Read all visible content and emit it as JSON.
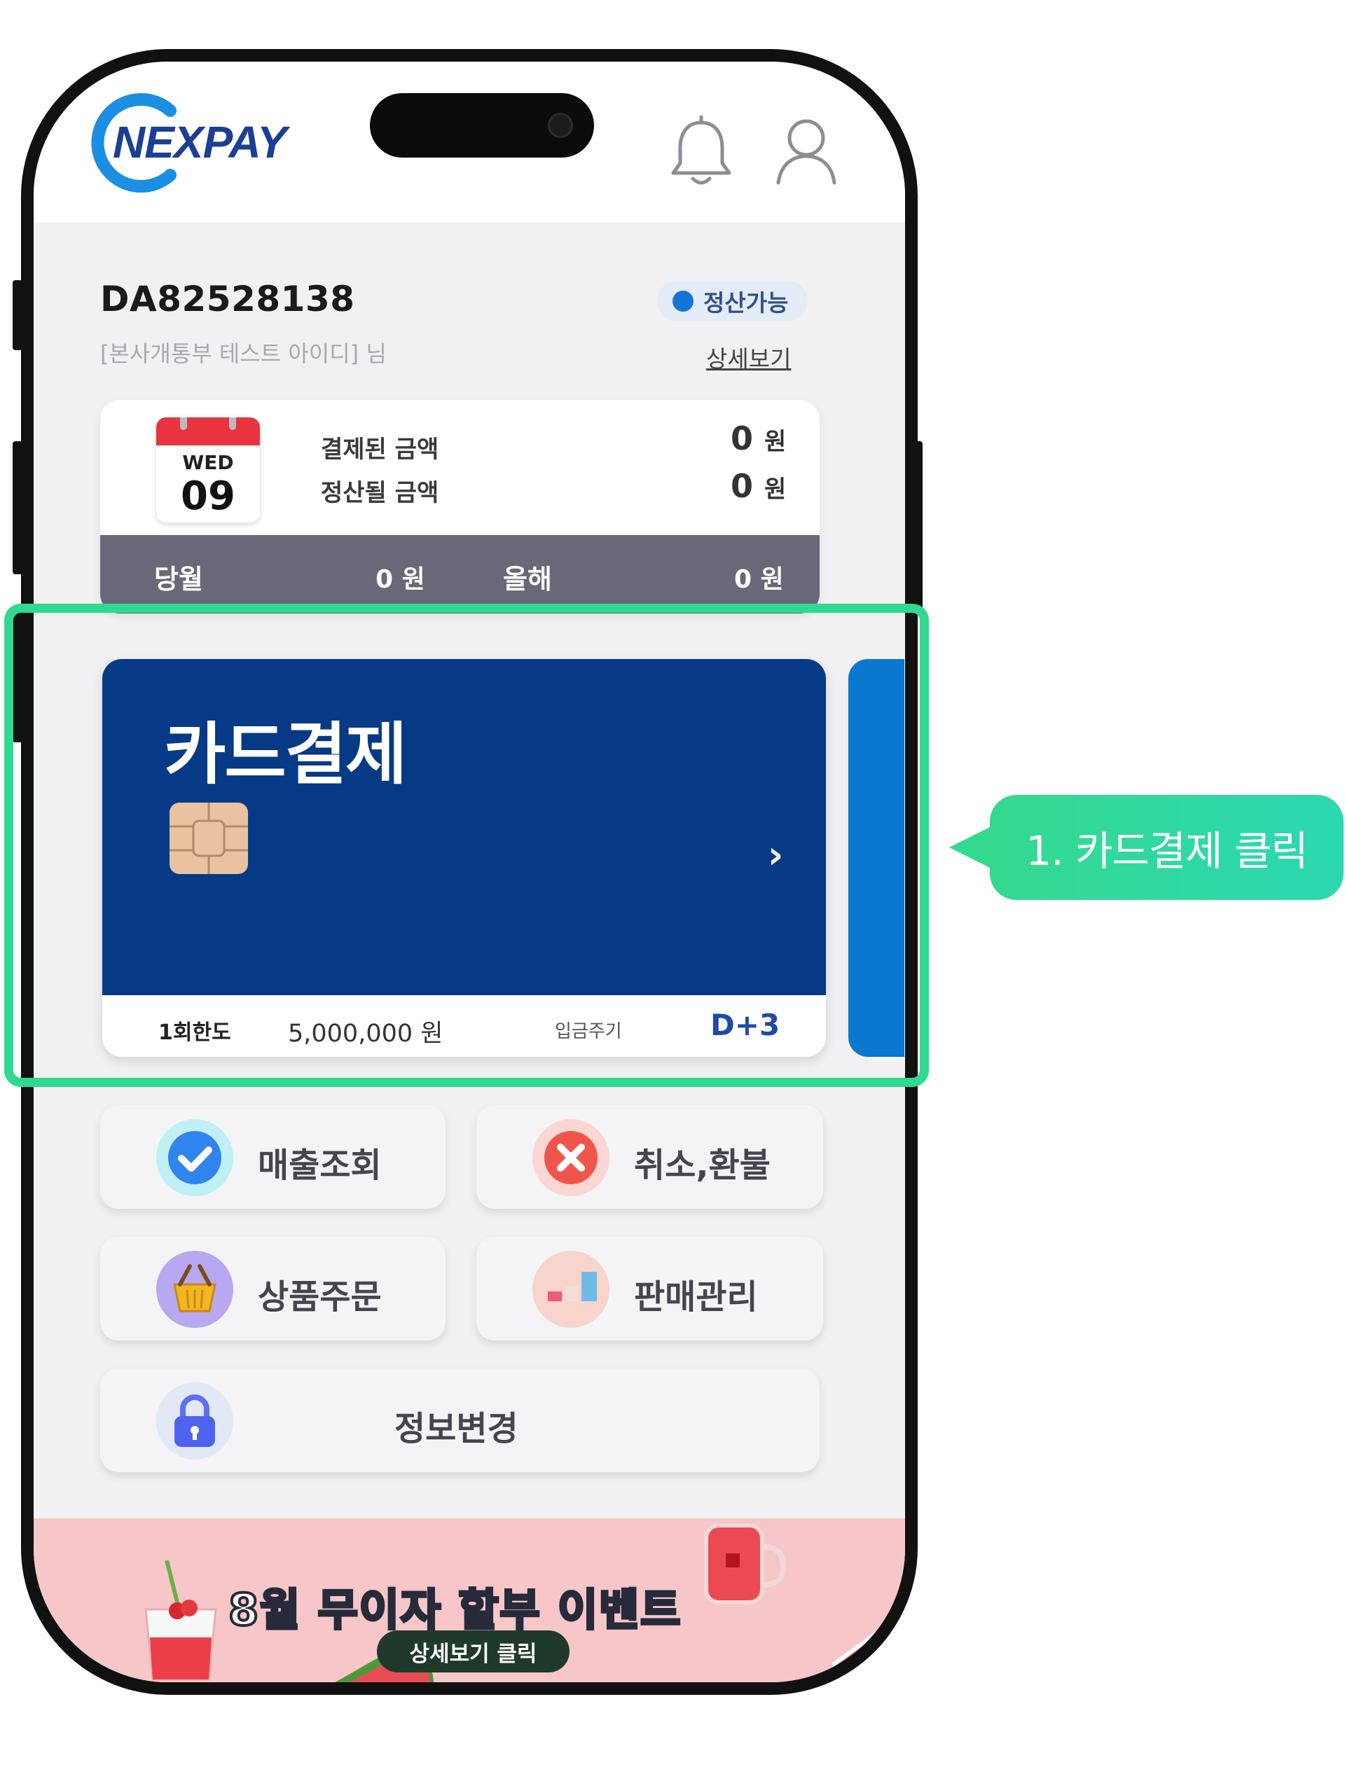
{
  "app": {
    "brand": "NEXPAY"
  },
  "header": {
    "notification_icon": "bell-icon",
    "profile_icon": "user-icon"
  },
  "account": {
    "id": "DA82528138",
    "subtitle": "[본사개통부 테스트 아이디] 님",
    "status": "정산가능",
    "detail_link": "상세보기"
  },
  "summary": {
    "calendar": {
      "weekday": "WED",
      "day": "09"
    },
    "paid_label": "결제된 금액",
    "paid_value": "0",
    "settle_label": "정산될 금액",
    "settle_value": "0",
    "unit": "원",
    "month_label": "당월",
    "month_value": "0 원",
    "year_label": "올해",
    "year_value": "0 원"
  },
  "pay_card": {
    "title": "카드결제",
    "chevron": "›",
    "limit_label": "1회한도",
    "limit_value": "5,000,000 원",
    "cycle_label": "입금주기",
    "cycle_value": "D+3"
  },
  "annotation": {
    "callout": "1. 카드결제 클릭"
  },
  "menu": {
    "sales": "매출조회",
    "refund": "취소,환불",
    "order": "상품주문",
    "manage": "판매관리",
    "info": "정보변경"
  },
  "banner": {
    "title": "8월 무이자 할부 이벤트",
    "button": "상세보기 클릭"
  },
  "colors": {
    "card_blue": "#063a86",
    "highlight_green": "#2fd98f",
    "accent_blue": "#1673d8"
  }
}
